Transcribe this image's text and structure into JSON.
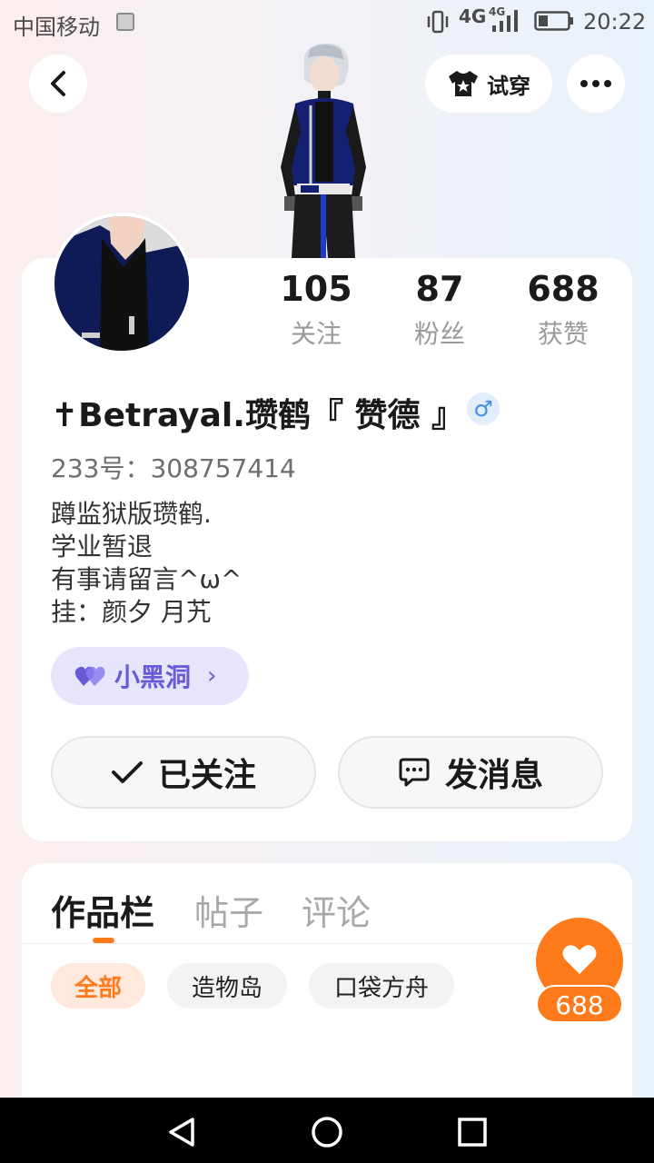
{
  "status_bar": {
    "carrier": "中国移动",
    "network_1": "4G",
    "network_2": "4G",
    "time": "20:22"
  },
  "header": {
    "try_on_label": "试穿"
  },
  "stats": {
    "following": {
      "value": "105",
      "label": "关注"
    },
    "fans": {
      "value": "87",
      "label": "粉丝"
    },
    "likes": {
      "value": "688",
      "label": "获赞"
    }
  },
  "profile": {
    "username": "✝Betrayal.瓒鹤『 赞德 』",
    "gender_symbol": "♂",
    "user_id": "233号：308757414",
    "bio": [
      "蹲监狱版瓒鹤.",
      "学业暂退",
      "有事请留言^ω^",
      "挂：颜夕  月艽"
    ],
    "blackhole_label": "小黑洞",
    "followed_label": "已关注",
    "message_label": "发消息"
  },
  "works": {
    "tabs": [
      "作品栏",
      "帖子",
      "评论"
    ],
    "active_tab": 0,
    "chips": [
      "全部",
      "造物岛",
      "口袋方舟"
    ],
    "active_chip": 0,
    "like_count": "688"
  },
  "colors": {
    "accent": "#ff7a1a",
    "blackhole_text": "#6b5ad8",
    "gender": "#3e8ee8"
  }
}
